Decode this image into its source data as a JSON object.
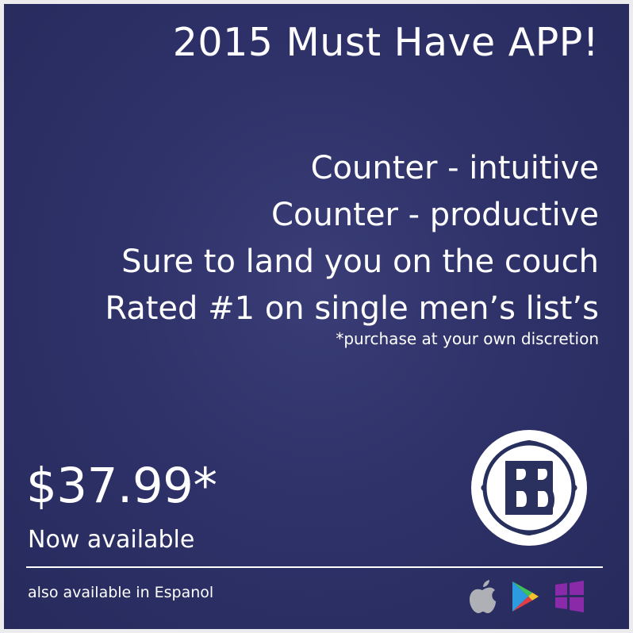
{
  "ad": {
    "headline": "2015 Must Have APP!",
    "features": [
      "Counter - intuitive",
      "Counter - productive",
      "Sure to land you on the couch",
      "Rated #1 on single men’s list’s"
    ],
    "disclaimer": "*purchase at your own discretion",
    "price": "$37.99*",
    "availability": "Now available",
    "language_note": "also available in Espanol",
    "logo_icon": "bb-monogram-logo-icon",
    "store_icons": [
      "apple-icon",
      "google-play-icon",
      "windows-icon"
    ],
    "colors": {
      "background": "#2f3269",
      "text": "#ffffff",
      "apple_icon": "#aeb0b6",
      "windows_icon": "#8b2aa8",
      "play_green": "#3ec05b",
      "play_blue": "#2c9be0",
      "play_yellow": "#f5c02e",
      "play_red": "#e23d43"
    }
  }
}
